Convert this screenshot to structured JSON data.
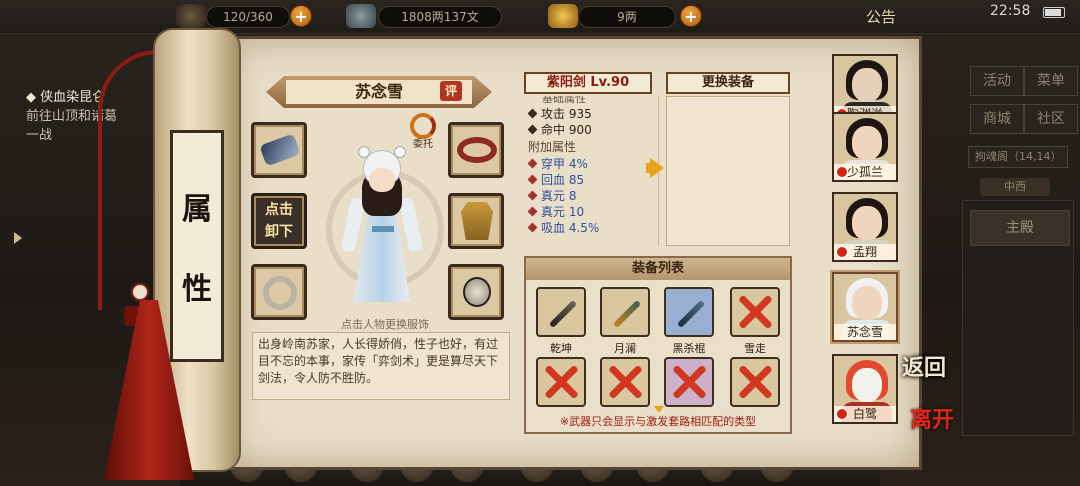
{
  "top_bar": {
    "stamina": "120/360",
    "money": "1808两137文",
    "gold": "9两",
    "notice": "公告",
    "time": "22:58"
  },
  "quest": {
    "title": "侠血染昆仑",
    "desc": "前往山顶和诸葛",
    "desc2": "一战"
  },
  "right_menu": {
    "items": [
      "活动",
      "菜单",
      "商城",
      "社区"
    ],
    "location": "拘魂阁（14,14）",
    "tab": "中西",
    "main": "主殿"
  },
  "scroll": {
    "roller_text": "属性",
    "character_name": "苏念雪",
    "rate_button": "评",
    "delegate_label": "委托",
    "unload_label": "点击卸下",
    "change_outfit_hint": "点击人物更换服饰",
    "description": "出身岭南苏家，人长得娇俏，性子也好，有过目不忘的本事，家传「弈剑术」更是算尽天下剑法，令人防不胜防。"
  },
  "weapon": {
    "title": "紫阳剑 Lv.90",
    "base_stats": [
      {
        "label": "攻击",
        "value": "935"
      },
      {
        "label": "命中",
        "value": "900"
      }
    ],
    "bonus_header": "附加属性",
    "bonus_stats": [
      {
        "label": "穿甲",
        "value": "4%"
      },
      {
        "label": "回血",
        "value": "85"
      },
      {
        "label": "真元",
        "value": "8"
      },
      {
        "label": "真元",
        "value": "10"
      },
      {
        "label": "吸血",
        "value": "4.5%"
      }
    ]
  },
  "change_equipment": {
    "title": "更换装备"
  },
  "equipment_list": {
    "title": "装备列表",
    "items": [
      {
        "name": "乾坤",
        "usable": true
      },
      {
        "name": "月澜",
        "usable": true
      },
      {
        "name": "黑杀棍",
        "usable": true
      },
      {
        "name": "雪走",
        "usable": false
      },
      {
        "name": "",
        "usable": false
      },
      {
        "name": "",
        "usable": false
      },
      {
        "name": "",
        "usable": false
      },
      {
        "name": "",
        "usable": false
      }
    ],
    "warning": "※武器只会显示与激发套路相匹配的类型"
  },
  "party": {
    "members": [
      {
        "name": "陶渊溢"
      },
      {
        "name": "少孤兰"
      },
      {
        "name": "孟翔"
      },
      {
        "name": "苏念雪"
      },
      {
        "name": "白鹭"
      }
    ]
  },
  "actions": {
    "back": "返回",
    "leave": "离开"
  },
  "colors": {
    "accent_red": "#d2371f",
    "accent_orange": "#e7a31a",
    "bonus_stat_blue": "#2e4f9e",
    "parchment": "#e9dfc9"
  }
}
